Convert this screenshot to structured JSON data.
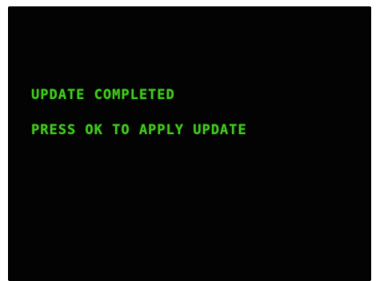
{
  "screen": {
    "background_color": "#020302",
    "text_color": "#3ec21a",
    "lines": [
      "UPDATE COMPLETED",
      "PRESS OK TO APPLY UPDATE"
    ]
  }
}
